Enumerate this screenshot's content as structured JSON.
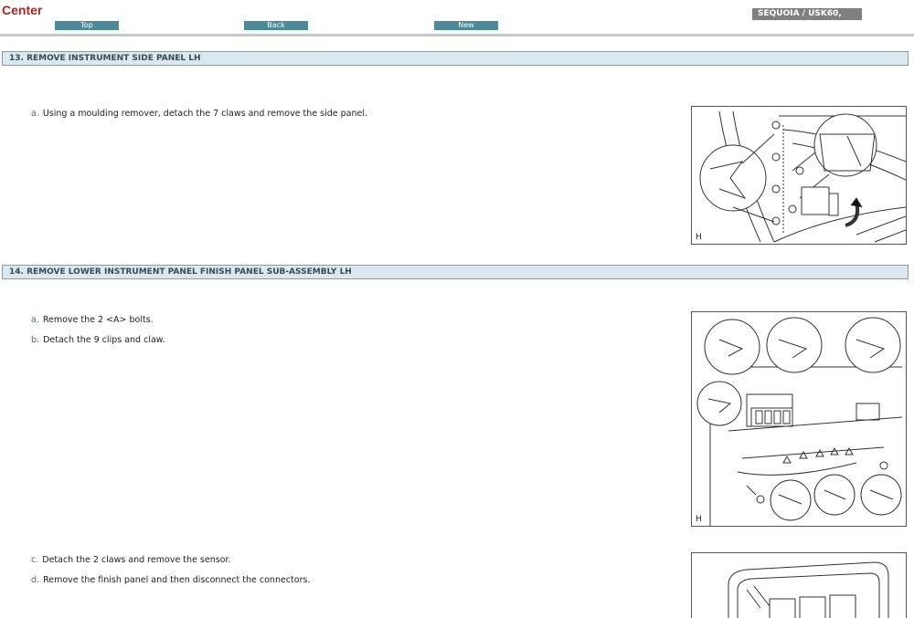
{
  "header": {
    "title": "Center",
    "nav": {
      "top": "Top",
      "back": "Back",
      "new": "New"
    },
    "model": "SEQUOIA / USK60,"
  },
  "sections": [
    {
      "heading": "13. REMOVE INSTRUMENT SIDE PANEL LH",
      "steps": [
        {
          "label": "a.",
          "text": "Using a moulding remover, detach the 7 claws and remove the side panel."
        }
      ],
      "figure_label": "H"
    },
    {
      "heading": "14. REMOVE LOWER INSTRUMENT PANEL FINISH PANEL SUB-ASSEMBLY LH",
      "steps": [
        {
          "label": "a.",
          "text": "Remove the 2 <A> bolts."
        },
        {
          "label": "b.",
          "text": "Detach the 9 clips and claw."
        },
        {
          "label": "c.",
          "text": "Detach the 2 claws and remove the sensor."
        },
        {
          "label": "d.",
          "text": "Remove the finish panel and then disconnect the connectors."
        }
      ],
      "figure_label": "H"
    }
  ]
}
